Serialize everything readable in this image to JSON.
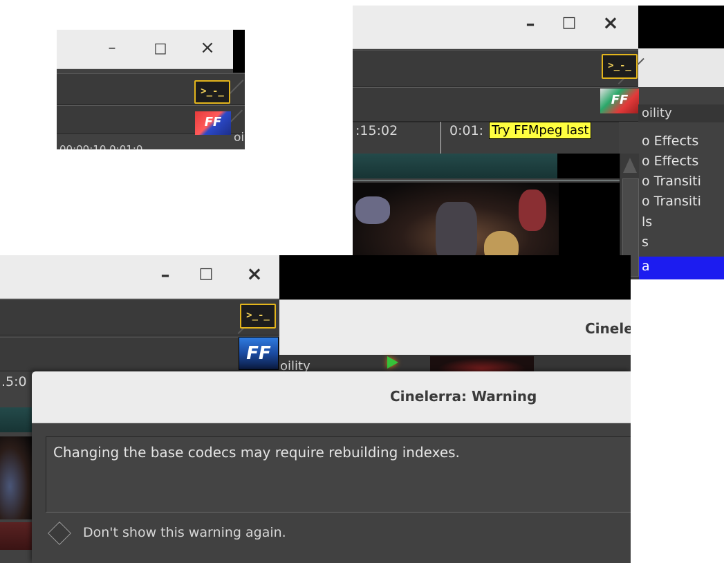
{
  "window_controls": {
    "minimize": "–",
    "maximize": "□",
    "close": "×"
  },
  "icons": {
    "terminal": "terminal-icon",
    "ffmpeg_colored": "ffmpeg-try-last-icon",
    "ffmpeg_blue": "ffmpeg-icon"
  },
  "panel_top_left": {
    "partial_text_right": "oi",
    "partial_text_bottom": "00:00:10   0:01:0"
  },
  "panel_top_right": {
    "timecode_1": ":15:02",
    "timecode_2": "0:01:",
    "tab_label": "oility",
    "tooltip": "Try FFMpeg last",
    "resource_items": [
      "o Effects",
      "o Effects",
      "o Transiti",
      "o Transiti",
      "ls",
      "s",
      "a"
    ]
  },
  "panel_bottom": {
    "window_title": "Cinele",
    "tab_label": "oility",
    "timecode": ".5:0",
    "dialog": {
      "title": "Cinelerra: Warning",
      "message": "Changing the base codecs may require rebuilding indexes.",
      "checkbox_label": "Don't show this warning again."
    }
  },
  "colors": {
    "tooltip_bg": "#ffff40",
    "selection_blue": "#1c1cf0",
    "accent_yellow": "#e3b51c",
    "dark_panel": "#414141",
    "teal_track": "#1c3b3b"
  }
}
